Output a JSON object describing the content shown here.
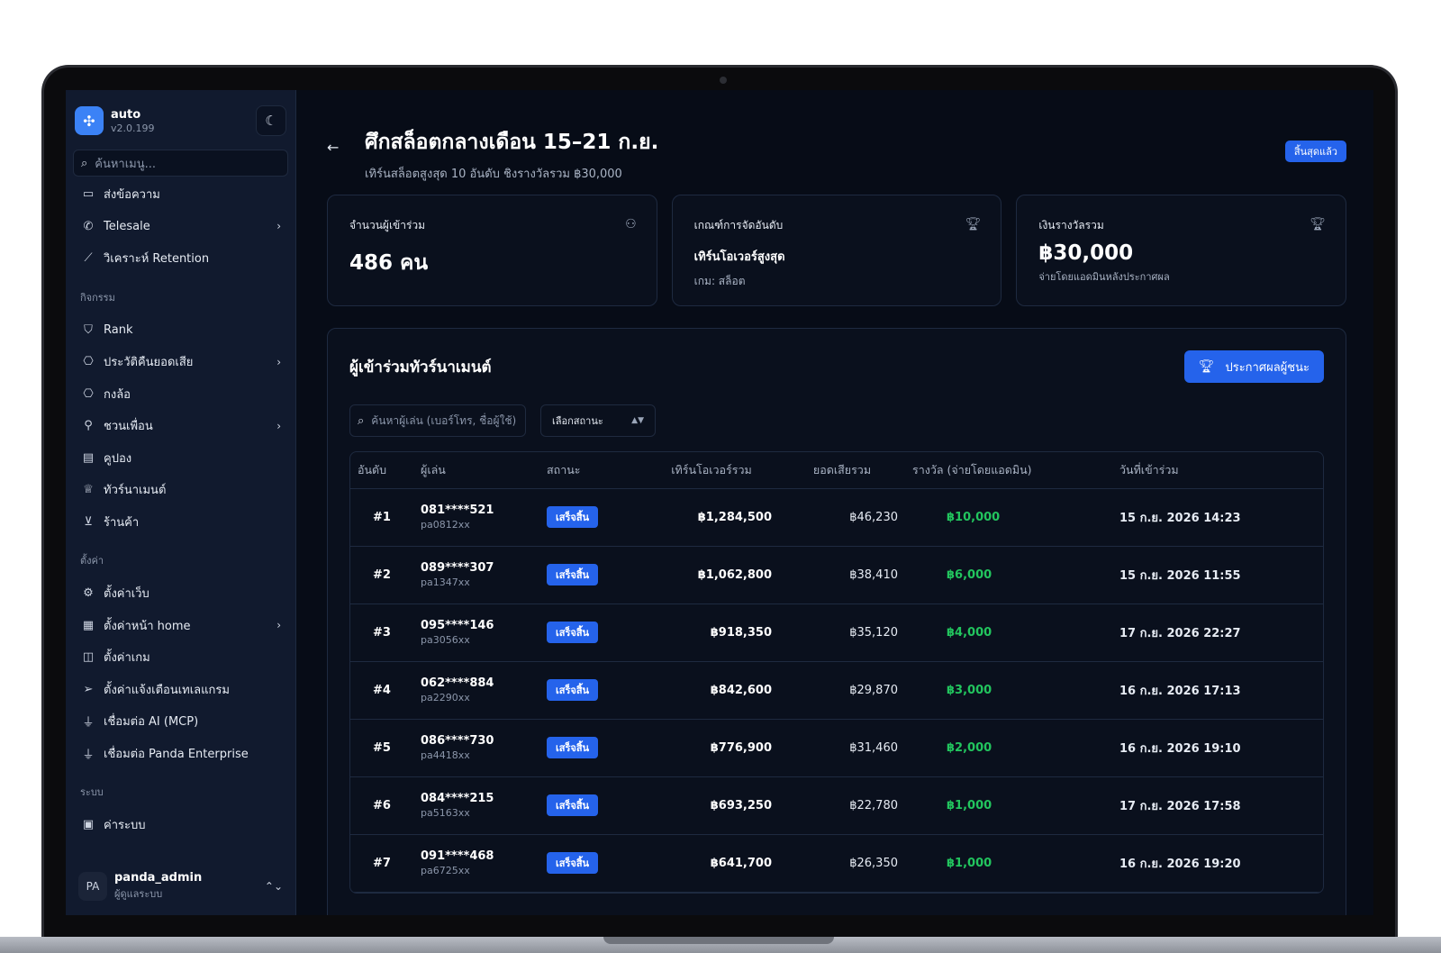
{
  "app": {
    "name": "auto",
    "version": "v2.0.199"
  },
  "sidebar": {
    "search_placeholder": "ค้นหาเมนู...",
    "top_items": [
      {
        "label": "ส่งข้อความ",
        "icon": "message-icon"
      },
      {
        "label": "Telesale",
        "icon": "phone-icon",
        "has_submenu": true
      },
      {
        "label": "วิเคราะห์ Retention",
        "icon": "chart-line-icon"
      }
    ],
    "sections": [
      {
        "label": "กิจกรรม",
        "items": [
          {
            "label": "Rank",
            "icon": "shield-icon"
          },
          {
            "label": "ประวัติคืนยอดเสีย",
            "icon": "gift-icon",
            "has_submenu": true
          },
          {
            "label": "กงล้อ",
            "icon": "gift-icon"
          },
          {
            "label": "ชวนเพื่อน",
            "icon": "user-plus-icon",
            "has_submenu": true
          },
          {
            "label": "คูปอง",
            "icon": "ticket-icon"
          },
          {
            "label": "ทัวร์นาเมนต์",
            "icon": "trophy-icon"
          },
          {
            "label": "ร้านค้า",
            "icon": "cart-icon"
          }
        ]
      },
      {
        "label": "ตั้งค่า",
        "items": [
          {
            "label": "ตั้งค่าเว็บ",
            "icon": "gear-icon"
          },
          {
            "label": "ตั้งค่าหน้า home",
            "icon": "layout-icon",
            "has_submenu": true
          },
          {
            "label": "ตั้งค่าเกม",
            "icon": "gamepad-icon"
          },
          {
            "label": "ตั้งค่าแจ้งเตือนเทเลแกรม",
            "icon": "send-icon"
          },
          {
            "label": "เชื่อมต่อ AI (MCP)",
            "icon": "plug-icon"
          },
          {
            "label": "เชื่อมต่อ Panda Enterprise",
            "icon": "plug-icon"
          }
        ]
      },
      {
        "label": "ระบบ",
        "items": [
          {
            "label": "ค่าระบบ",
            "icon": "wallet-icon"
          }
        ]
      }
    ],
    "user": {
      "initials": "PA",
      "name": "panda_admin",
      "role": "ผู้ดูแลระบบ"
    }
  },
  "header": {
    "title": "ศึกสล็อตกลางเดือน 15–21 ก.ย.",
    "subtitle": "เทิร์นสล็อตสูงสุด 10 อันดับ ชิงรางวัลรวม ฿30,000",
    "status": "สิ้นสุดแล้ว"
  },
  "stats": {
    "participants": {
      "label": "จำนวนผู้เข้าร่วม",
      "value": "486 คน"
    },
    "criteria": {
      "label": "เกณฑ์การจัดอันดับ",
      "value": "เทิร์นโอเวอร์สูงสุด",
      "note": "เกม: สล็อต"
    },
    "prize": {
      "label": "เงินรางวัลรวม",
      "value": "฿30,000",
      "note": "จ่ายโดยแอดมินหลังประกาศผล"
    }
  },
  "panel": {
    "title": "ผู้เข้าร่วมทัวร์นาเมนต์",
    "announce_label": "ประกาศผลผู้ชนะ",
    "search_placeholder": "ค้นหาผู้เล่น (เบอร์โทร, ชื่อผู้ใช้)",
    "status_select": "เลือกสถานะ"
  },
  "table": {
    "headers": [
      "อันดับ",
      "ผู้เล่น",
      "สถานะ",
      "เทิร์นโอเวอร์รวม",
      "ยอดเสียรวม",
      "รางวัล (จ่ายโดยแอดมิน)",
      "วันที่เข้าร่วม"
    ],
    "rows": [
      {
        "rank": "#1",
        "phone": "081****521",
        "user": "pa0812xx",
        "status": "เสร็จสิ้น",
        "turnover": "฿1,284,500",
        "loss": "฿46,230",
        "prize": "฿10,000",
        "date": "15 ก.ย. 2026 14:23"
      },
      {
        "rank": "#2",
        "phone": "089****307",
        "user": "pa1347xx",
        "status": "เสร็จสิ้น",
        "turnover": "฿1,062,800",
        "loss": "฿38,410",
        "prize": "฿6,000",
        "date": "15 ก.ย. 2026 11:55"
      },
      {
        "rank": "#3",
        "phone": "095****146",
        "user": "pa3056xx",
        "status": "เสร็จสิ้น",
        "turnover": "฿918,350",
        "loss": "฿35,120",
        "prize": "฿4,000",
        "date": "17 ก.ย. 2026 22:27"
      },
      {
        "rank": "#4",
        "phone": "062****884",
        "user": "pa2290xx",
        "status": "เสร็จสิ้น",
        "turnover": "฿842,600",
        "loss": "฿29,870",
        "prize": "฿3,000",
        "date": "16 ก.ย. 2026 17:13"
      },
      {
        "rank": "#5",
        "phone": "086****730",
        "user": "pa4418xx",
        "status": "เสร็จสิ้น",
        "turnover": "฿776,900",
        "loss": "฿31,460",
        "prize": "฿2,000",
        "date": "16 ก.ย. 2026 19:10"
      },
      {
        "rank": "#6",
        "phone": "084****215",
        "user": "pa5163xx",
        "status": "เสร็จสิ้น",
        "turnover": "฿693,250",
        "loss": "฿22,780",
        "prize": "฿1,000",
        "date": "17 ก.ย. 2026 17:58"
      },
      {
        "rank": "#7",
        "phone": "091****468",
        "user": "pa6725xx",
        "status": "เสร็จสิ้น",
        "turnover": "฿641,700",
        "loss": "฿26,350",
        "prize": "฿1,000",
        "date": "16 ก.ย. 2026 19:20"
      }
    ]
  },
  "colors": {
    "accent": "#2563eb",
    "prize": "#22c55e",
    "background": "#070c17",
    "sidebar": "#111a2e"
  }
}
